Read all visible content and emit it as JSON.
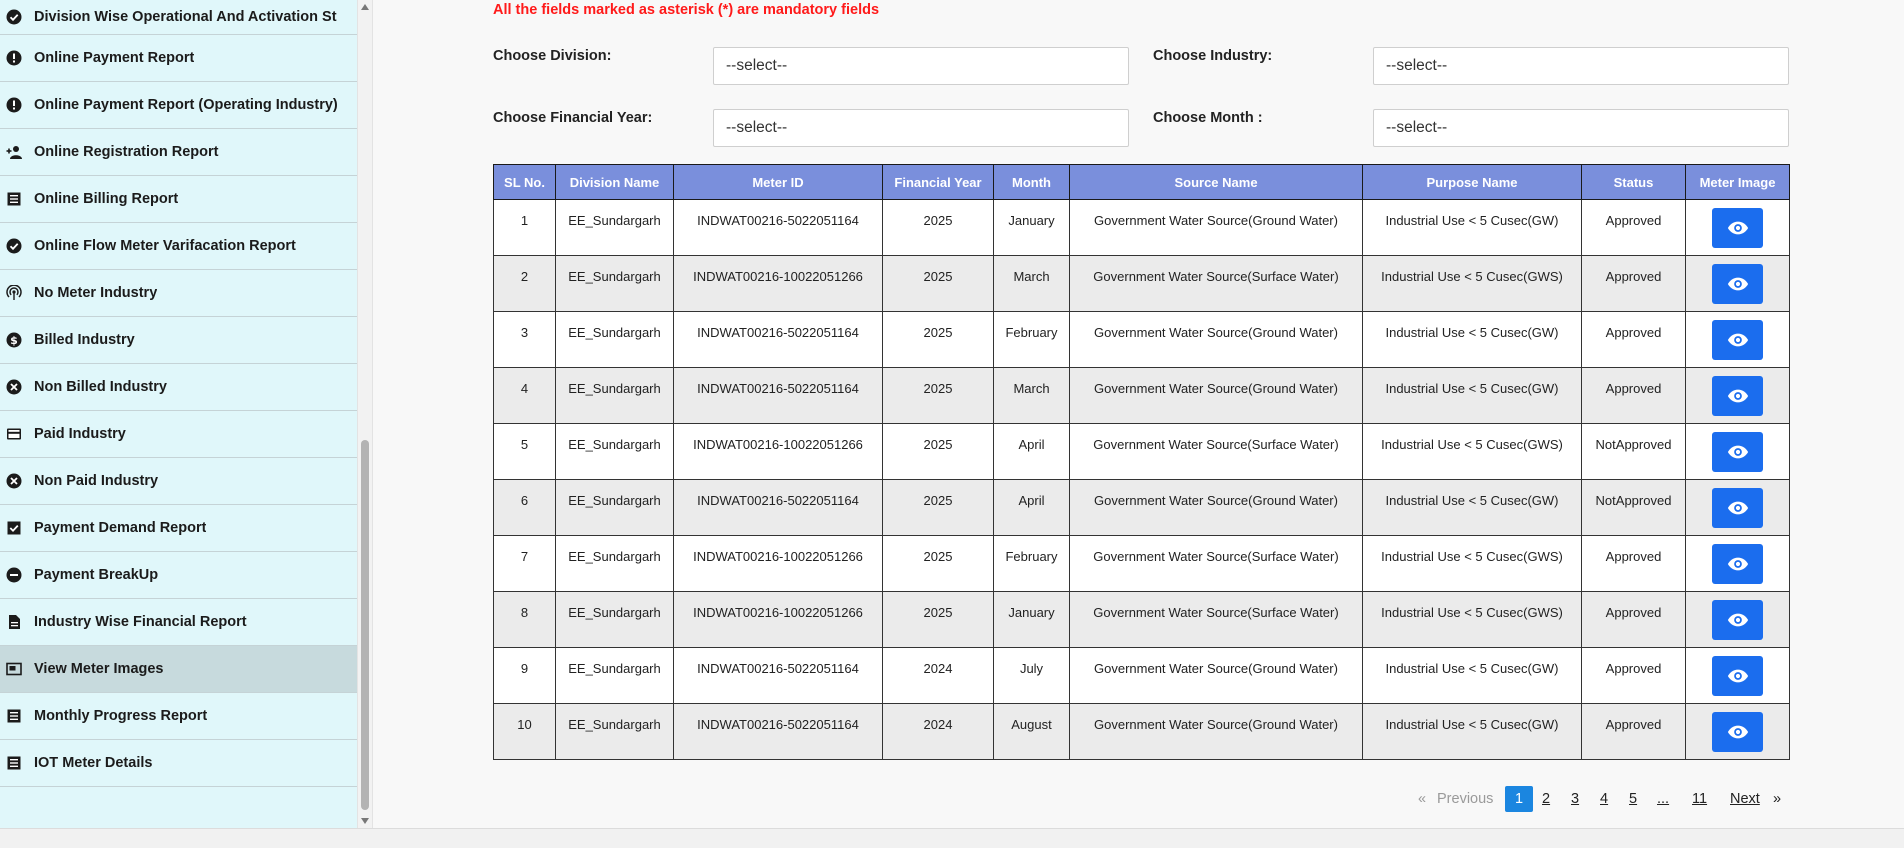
{
  "sidebar": {
    "items": [
      {
        "label": "Division Wise Operational And Activation St",
        "icon": "check-circle-icon"
      },
      {
        "label": "Online Payment Report",
        "icon": "alert-circle-icon"
      },
      {
        "label": "Online Payment Report (Operating Industry)",
        "icon": "alert-circle-icon"
      },
      {
        "label": "Online Registration Report",
        "icon": "person-add-icon"
      },
      {
        "label": "Online Billing Report",
        "icon": "list-doc-icon"
      },
      {
        "label": "Online Flow Meter Varifacation Report",
        "icon": "check-circle-icon"
      },
      {
        "label": "No Meter Industry",
        "icon": "antenna-icon"
      },
      {
        "label": "Billed Industry",
        "icon": "dollar-circle-icon"
      },
      {
        "label": "Non Billed Industry",
        "icon": "cancel-circle-icon"
      },
      {
        "label": "Paid Industry",
        "icon": "credit-card-icon"
      },
      {
        "label": "Non Paid Industry",
        "icon": "cancel-circle-icon"
      },
      {
        "label": "Payment Demand Report",
        "icon": "checkbox-icon"
      },
      {
        "label": "Payment BreakUp",
        "icon": "minus-circle-icon"
      },
      {
        "label": "Industry Wise Financial Report",
        "icon": "document-icon"
      },
      {
        "label": "View Meter Images",
        "icon": "image-frame-icon",
        "active": true
      },
      {
        "label": "Monthly Progress Report",
        "icon": "list-doc-icon"
      },
      {
        "label": "IOT Meter Details",
        "icon": "list-doc-icon"
      }
    ]
  },
  "form": {
    "notice": "All the fields marked as asterisk (*) are mandatory fields",
    "division_label": "Choose Division:",
    "division_value": "--select--",
    "industry_label": "Choose Industry:",
    "industry_value": "--select--",
    "fy_label": "Choose Financial Year:",
    "fy_value": "--select--",
    "month_label": "Choose Month :",
    "month_value": "--select--"
  },
  "table": {
    "headers": [
      "SL No.",
      "Division Name",
      "Meter ID",
      "Financial Year",
      "Month",
      "Source Name",
      "Purpose Name",
      "Status",
      "Meter Image"
    ],
    "rows": [
      [
        "1",
        "EE_Sundargarh",
        "INDWAT00216-5022051164",
        "2025",
        "January",
        "Government Water Source(Ground Water)",
        "Industrial Use < 5 Cusec(GW)",
        "Approved"
      ],
      [
        "2",
        "EE_Sundargarh",
        "INDWAT00216-10022051266",
        "2025",
        "March",
        "Government Water Source(Surface Water)",
        "Industrial Use < 5 Cusec(GWS)",
        "Approved"
      ],
      [
        "3",
        "EE_Sundargarh",
        "INDWAT00216-5022051164",
        "2025",
        "February",
        "Government Water Source(Ground Water)",
        "Industrial Use < 5 Cusec(GW)",
        "Approved"
      ],
      [
        "4",
        "EE_Sundargarh",
        "INDWAT00216-5022051164",
        "2025",
        "March",
        "Government Water Source(Ground Water)",
        "Industrial Use < 5 Cusec(GW)",
        "Approved"
      ],
      [
        "5",
        "EE_Sundargarh",
        "INDWAT00216-10022051266",
        "2025",
        "April",
        "Government Water Source(Surface Water)",
        "Industrial Use < 5 Cusec(GWS)",
        "NotApproved"
      ],
      [
        "6",
        "EE_Sundargarh",
        "INDWAT00216-5022051164",
        "2025",
        "April",
        "Government Water Source(Ground Water)",
        "Industrial Use < 5 Cusec(GW)",
        "NotApproved"
      ],
      [
        "7",
        "EE_Sundargarh",
        "INDWAT00216-10022051266",
        "2025",
        "February",
        "Government Water Source(Surface Water)",
        "Industrial Use < 5 Cusec(GWS)",
        "Approved"
      ],
      [
        "8",
        "EE_Sundargarh",
        "INDWAT00216-10022051266",
        "2025",
        "January",
        "Government Water Source(Surface Water)",
        "Industrial Use < 5 Cusec(GWS)",
        "Approved"
      ],
      [
        "9",
        "EE_Sundargarh",
        "INDWAT00216-5022051164",
        "2024",
        "July",
        "Government Water Source(Ground Water)",
        "Industrial Use < 5 Cusec(GW)",
        "Approved"
      ],
      [
        "10",
        "EE_Sundargarh",
        "INDWAT00216-5022051164",
        "2024",
        "August",
        "Government Water Source(Ground Water)",
        "Industrial Use < 5 Cusec(GW)",
        "Approved"
      ]
    ],
    "image_button_icon": "eye-icon"
  },
  "pagination": {
    "prev_arrow": "«",
    "previous": "Previous",
    "pages": [
      "1",
      "2",
      "3",
      "4",
      "5"
    ],
    "ellipsis": "...",
    "last": "11",
    "next": "Next",
    "next_arrow": "»",
    "current": "1"
  },
  "colors": {
    "sidebar_bg": "#e0f7fa",
    "active_item": "#c7dadd",
    "table_header": "#7a8fdc",
    "eye_button": "#1b6dee",
    "notice": "#ff1a1a",
    "page_current": "#1b86e0"
  }
}
